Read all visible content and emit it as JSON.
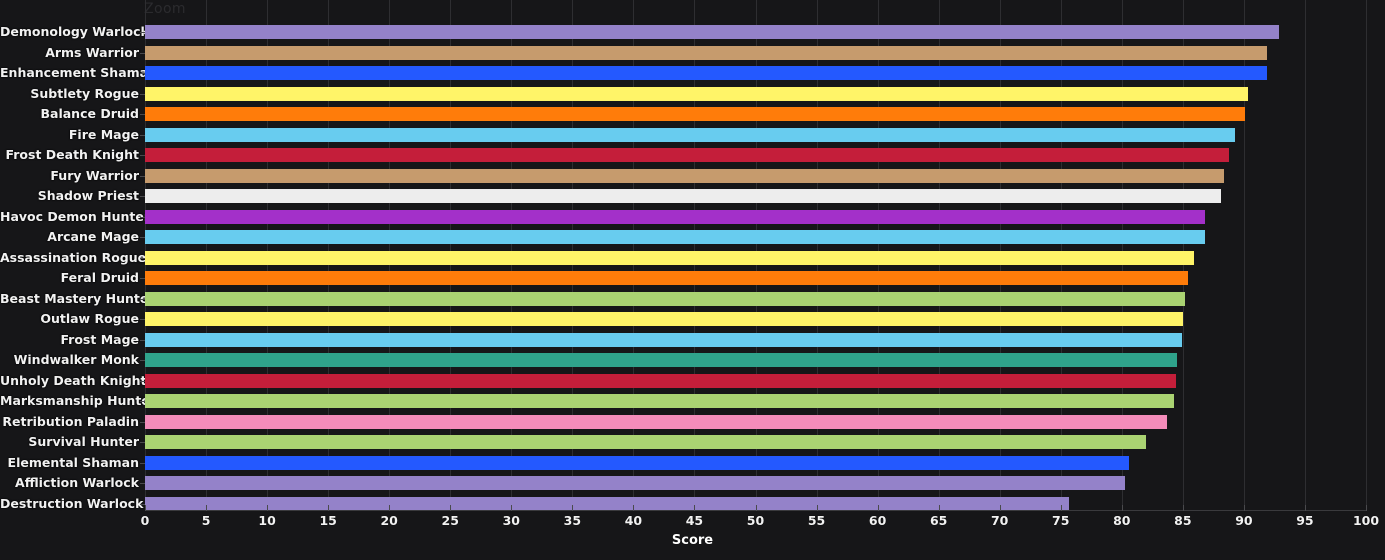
{
  "header": {
    "zoom_label": "Zoom"
  },
  "axis": {
    "x_title": "Score",
    "x_ticks": [
      "0",
      "5",
      "10",
      "15",
      "20",
      "25",
      "30",
      "35",
      "40",
      "45",
      "50",
      "55",
      "60",
      "65",
      "70",
      "75",
      "80",
      "85",
      "90",
      "95",
      "100"
    ]
  },
  "theme": {
    "background": "#161618",
    "gridline": "#2e2e31",
    "tick": "#4a4a4d",
    "label_text": "#f2f2f2",
    "zoom_text": "#2b2b2e"
  },
  "chart_data": {
    "type": "bar",
    "orientation": "horizontal",
    "title": "",
    "xlabel": "Score",
    "ylabel": "",
    "xlim": [
      0,
      100
    ],
    "grid": true,
    "legend": "none",
    "categories": [
      "Demonology Warlock",
      "Arms Warrior",
      "Enhancement Shaman",
      "Subtlety Rogue",
      "Balance Druid",
      "Fire Mage",
      "Frost Death Knight",
      "Fury Warrior",
      "Shadow Priest",
      "Havoc Demon Hunter",
      "Arcane Mage",
      "Assassination Rogue",
      "Feral Druid",
      "Beast Mastery Hunter",
      "Outlaw Rogue",
      "Frost Mage",
      "Windwalker Monk",
      "Unholy Death Knight",
      "Marksmanship Hunter",
      "Retribution Paladin",
      "Survival Hunter",
      "Elemental Shaman",
      "Affliction Warlock",
      "Destruction Warlock"
    ],
    "values": [
      92.9,
      91.9,
      91.9,
      90.3,
      90.1,
      89.3,
      88.8,
      88.4,
      88.1,
      86.8,
      86.8,
      85.9,
      85.4,
      85.2,
      85.0,
      84.9,
      84.5,
      84.4,
      84.3,
      83.7,
      82.0,
      80.6,
      80.3,
      75.7
    ],
    "colors": [
      "#9482c9",
      "#c69b6d",
      "#2459ff",
      "#fff468",
      "#ff7c0a",
      "#68ccef",
      "#c41e3a",
      "#c69b6d",
      "#ededed",
      "#a330c9",
      "#68ccef",
      "#fff468",
      "#ff7c0a",
      "#aad372",
      "#fff468",
      "#68ccef",
      "#2fa38b",
      "#c41e3a",
      "#aad372",
      "#f48cba",
      "#aad372",
      "#2459ff",
      "#9482c9",
      "#9482c9"
    ]
  }
}
